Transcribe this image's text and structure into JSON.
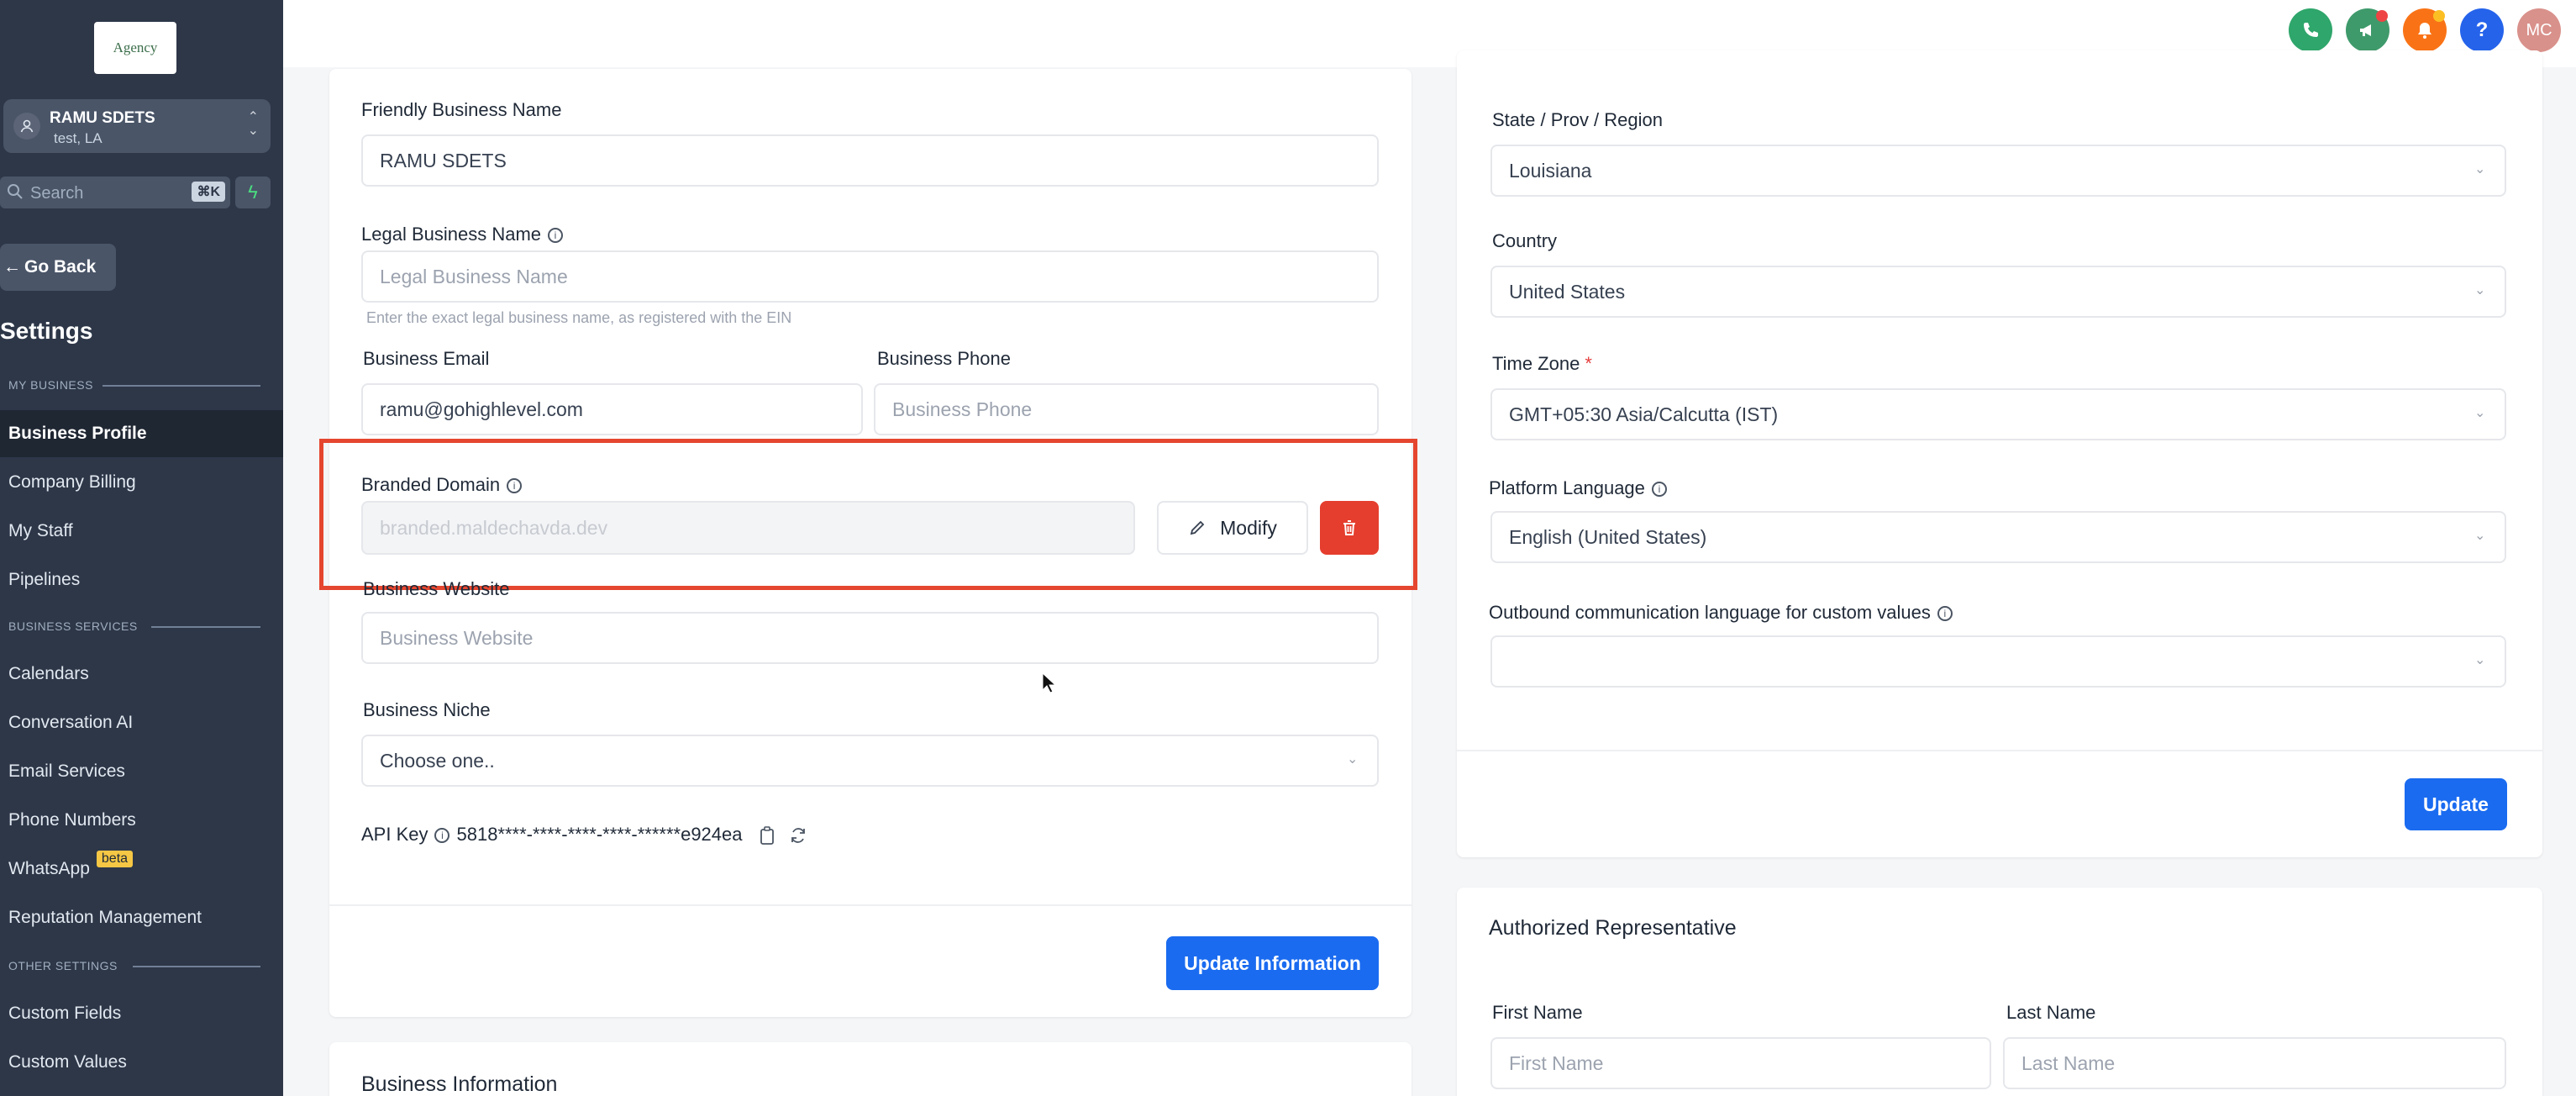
{
  "sidebar": {
    "logo_text": "Agency",
    "account": {
      "name": "RAMU SDETS",
      "location": "test, LA"
    },
    "search": {
      "placeholder": "Search",
      "shortcut": "⌘K"
    },
    "go_back": "Go Back",
    "settings_title": "Settings",
    "sections": {
      "my_business": "MY BUSINESS",
      "business_services": "BUSINESS SERVICES",
      "other_settings": "OTHER SETTINGS"
    },
    "items": [
      {
        "label": "Business Profile"
      },
      {
        "label": "Company Billing"
      },
      {
        "label": "My Staff"
      },
      {
        "label": "Pipelines"
      },
      {
        "label": "Calendars"
      },
      {
        "label": "Conversation AI"
      },
      {
        "label": "Email Services"
      },
      {
        "label": "Phone Numbers"
      },
      {
        "label": "WhatsApp",
        "badge": "beta"
      },
      {
        "label": "Reputation Management"
      },
      {
        "label": "Custom Fields"
      },
      {
        "label": "Custom Values"
      }
    ]
  },
  "topbar": {
    "avatar_initials": "MC",
    "help_glyph": "?"
  },
  "business_form": {
    "friendly_name": {
      "label": "Friendly Business Name",
      "value": "RAMU SDETS"
    },
    "legal_name": {
      "label": "Legal Business Name",
      "placeholder": "Legal Business Name",
      "helper": "Enter the exact legal business name, as registered with the EIN"
    },
    "email": {
      "label": "Business Email",
      "value": "ramu@gohighlevel.com"
    },
    "phone": {
      "label": "Business Phone",
      "placeholder": "Business Phone"
    },
    "branded_domain": {
      "label": "Branded Domain",
      "value": "branded.maldechavda.dev",
      "modify_label": "Modify"
    },
    "website": {
      "label": "Business Website",
      "placeholder": "Business Website"
    },
    "niche": {
      "label": "Business Niche",
      "value": "Choose one.."
    },
    "api_key": {
      "label": "API Key",
      "value": "5818****-****-****-****-******e924ea"
    },
    "update_label": "Update Information"
  },
  "business_info": {
    "title": "Business Information"
  },
  "region_form": {
    "state": {
      "label": "State / Prov / Region",
      "value": "Louisiana"
    },
    "country": {
      "label": "Country",
      "value": "United States"
    },
    "timezone": {
      "label": "Time Zone",
      "required": "*",
      "value": "GMT+05:30 Asia/Calcutta (IST)"
    },
    "platform_language": {
      "label": "Platform Language",
      "value": "English (United States)"
    },
    "outbound_language": {
      "label": "Outbound communication language for custom values",
      "value": ""
    },
    "update_label": "Update"
  },
  "authorized_rep": {
    "title": "Authorized Representative",
    "first_name": {
      "label": "First Name",
      "placeholder": "First Name"
    },
    "last_name": {
      "label": "Last Name",
      "placeholder": "Last Name"
    }
  },
  "colors": {
    "sidebar_bg": "#2d3748",
    "primary": "#1a6bf0",
    "danger": "#e53e2e",
    "highlight": "#e5462f"
  }
}
